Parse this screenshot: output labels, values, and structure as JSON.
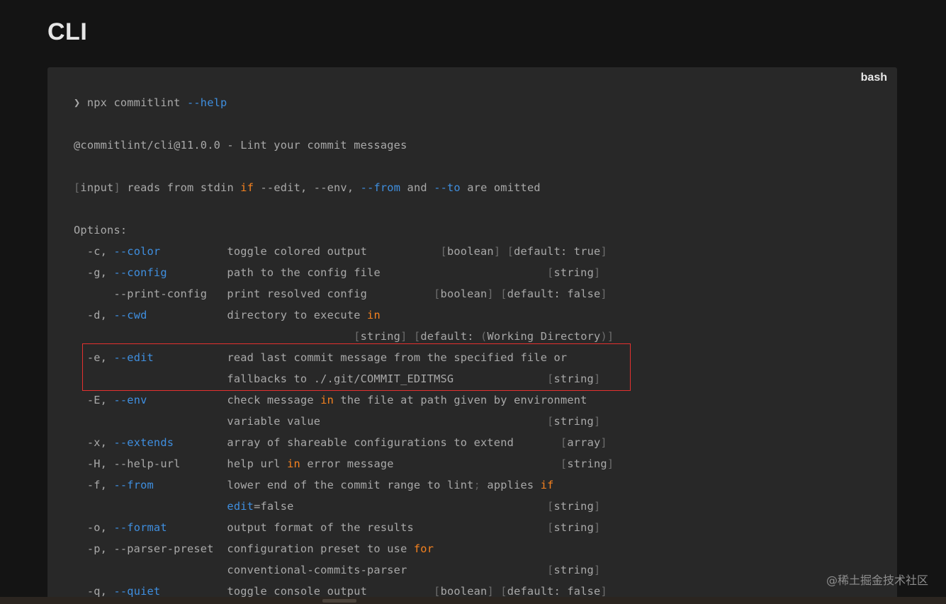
{
  "page": {
    "title": "CLI"
  },
  "code_block": {
    "language": "bash",
    "lines": [
      [
        {
          "t": "plain",
          "v": "❯ npx commitlint "
        },
        {
          "t": "flag",
          "v": "--help"
        }
      ],
      [],
      [
        {
          "t": "plain",
          "v": "@commitlint/cli@11.0.0 - Lint your commit messages"
        }
      ],
      [],
      [
        {
          "t": "br",
          "v": "["
        },
        {
          "t": "plain",
          "v": "input"
        },
        {
          "t": "br",
          "v": "]"
        },
        {
          "t": "plain",
          "v": " reads from stdin "
        },
        {
          "t": "kw",
          "v": "if"
        },
        {
          "t": "plain",
          "v": " --edit, --env, "
        },
        {
          "t": "flag",
          "v": "--from"
        },
        {
          "t": "plain",
          "v": " and "
        },
        {
          "t": "flag",
          "v": "--to"
        },
        {
          "t": "plain",
          "v": " are omitted"
        }
      ],
      [],
      [
        {
          "t": "plain",
          "v": "Options:"
        }
      ],
      [
        {
          "t": "plain",
          "v": "  -c, "
        },
        {
          "t": "flag",
          "v": "--color"
        },
        {
          "t": "plain",
          "v": "          toggle colored output           "
        },
        {
          "t": "br",
          "v": "["
        },
        {
          "t": "plain",
          "v": "boolean"
        },
        {
          "t": "br",
          "v": "]"
        },
        {
          "t": "plain",
          "v": " "
        },
        {
          "t": "br",
          "v": "["
        },
        {
          "t": "plain",
          "v": "default: true"
        },
        {
          "t": "br",
          "v": "]"
        }
      ],
      [
        {
          "t": "plain",
          "v": "  -g, "
        },
        {
          "t": "flag",
          "v": "--config"
        },
        {
          "t": "plain",
          "v": "         path to the config file                         "
        },
        {
          "t": "br",
          "v": "["
        },
        {
          "t": "plain",
          "v": "string"
        },
        {
          "t": "br",
          "v": "]"
        }
      ],
      [
        {
          "t": "plain",
          "v": "      --print-config   print resolved config          "
        },
        {
          "t": "br",
          "v": "["
        },
        {
          "t": "plain",
          "v": "boolean"
        },
        {
          "t": "br",
          "v": "]"
        },
        {
          "t": "plain",
          "v": " "
        },
        {
          "t": "br",
          "v": "["
        },
        {
          "t": "plain",
          "v": "default: false"
        },
        {
          "t": "br",
          "v": "]"
        }
      ],
      [
        {
          "t": "plain",
          "v": "  -d, "
        },
        {
          "t": "flag",
          "v": "--cwd"
        },
        {
          "t": "plain",
          "v": "            directory to execute "
        },
        {
          "t": "kw",
          "v": "in"
        }
      ],
      [
        {
          "t": "plain",
          "v": "                                          "
        },
        {
          "t": "br",
          "v": "["
        },
        {
          "t": "plain",
          "v": "string"
        },
        {
          "t": "br",
          "v": "]"
        },
        {
          "t": "plain",
          "v": " "
        },
        {
          "t": "br",
          "v": "["
        },
        {
          "t": "plain",
          "v": "default: "
        },
        {
          "t": "br",
          "v": "("
        },
        {
          "t": "plain",
          "v": "Working Directory"
        },
        {
          "t": "br",
          "v": ")"
        },
        {
          "t": "br",
          "v": "]"
        }
      ],
      [
        {
          "t": "plain",
          "v": "  -e, "
        },
        {
          "t": "flag",
          "v": "--edit"
        },
        {
          "t": "plain",
          "v": "           read last commit message from the specified file or"
        }
      ],
      [
        {
          "t": "plain",
          "v": "                       fallbacks to ./.git/COMMIT_EDITMSG              "
        },
        {
          "t": "br",
          "v": "["
        },
        {
          "t": "plain",
          "v": "string"
        },
        {
          "t": "br",
          "v": "]"
        }
      ],
      [
        {
          "t": "plain",
          "v": "  -E, "
        },
        {
          "t": "flag",
          "v": "--env"
        },
        {
          "t": "plain",
          "v": "            check message "
        },
        {
          "t": "kw",
          "v": "in"
        },
        {
          "t": "plain",
          "v": " the file at path given by environment"
        }
      ],
      [
        {
          "t": "plain",
          "v": "                       variable value                                  "
        },
        {
          "t": "br",
          "v": "["
        },
        {
          "t": "plain",
          "v": "string"
        },
        {
          "t": "br",
          "v": "]"
        }
      ],
      [
        {
          "t": "plain",
          "v": "  -x, "
        },
        {
          "t": "flag",
          "v": "--extends"
        },
        {
          "t": "plain",
          "v": "        array of shareable configurations to extend       "
        },
        {
          "t": "br",
          "v": "["
        },
        {
          "t": "plain",
          "v": "array"
        },
        {
          "t": "br",
          "v": "]"
        }
      ],
      [
        {
          "t": "plain",
          "v": "  -H, --help-url       help url "
        },
        {
          "t": "kw",
          "v": "in"
        },
        {
          "t": "plain",
          "v": " error message                         "
        },
        {
          "t": "br",
          "v": "["
        },
        {
          "t": "plain",
          "v": "string"
        },
        {
          "t": "br",
          "v": "]"
        }
      ],
      [
        {
          "t": "plain",
          "v": "  -f, "
        },
        {
          "t": "flag",
          "v": "--from"
        },
        {
          "t": "plain",
          "v": "           lower end of the commit range to lint"
        },
        {
          "t": "punc",
          "v": ";"
        },
        {
          "t": "plain",
          "v": " applies "
        },
        {
          "t": "kw",
          "v": "if"
        }
      ],
      [
        {
          "t": "plain",
          "v": "                       "
        },
        {
          "t": "flag",
          "v": "edit"
        },
        {
          "t": "plain",
          "v": "=false                                      "
        },
        {
          "t": "br",
          "v": "["
        },
        {
          "t": "plain",
          "v": "string"
        },
        {
          "t": "br",
          "v": "]"
        }
      ],
      [
        {
          "t": "plain",
          "v": "  -o, "
        },
        {
          "t": "flag",
          "v": "--format"
        },
        {
          "t": "plain",
          "v": "         output format of the results                    "
        },
        {
          "t": "br",
          "v": "["
        },
        {
          "t": "plain",
          "v": "string"
        },
        {
          "t": "br",
          "v": "]"
        }
      ],
      [
        {
          "t": "plain",
          "v": "  -p, --parser-preset  configuration preset to use "
        },
        {
          "t": "kw",
          "v": "for"
        }
      ],
      [
        {
          "t": "plain",
          "v": "                       conventional-commits-parser                     "
        },
        {
          "t": "br",
          "v": "["
        },
        {
          "t": "plain",
          "v": "string"
        },
        {
          "t": "br",
          "v": "]"
        }
      ],
      [
        {
          "t": "plain",
          "v": "  -q, "
        },
        {
          "t": "flag",
          "v": "--quiet"
        },
        {
          "t": "plain",
          "v": "          toggle console output          "
        },
        {
          "t": "br",
          "v": "["
        },
        {
          "t": "plain",
          "v": "boolean"
        },
        {
          "t": "br",
          "v": "]"
        },
        {
          "t": "plain",
          "v": " "
        },
        {
          "t": "br",
          "v": "["
        },
        {
          "t": "plain",
          "v": "default: false"
        },
        {
          "t": "br",
          "v": "]"
        }
      ]
    ]
  },
  "watermark": "@稀土掘金技术社区",
  "colors": {
    "page_bg": "#141414",
    "code_bg": "#282828",
    "keyword": "#f6821f",
    "flag": "#3f8fe0",
    "highlight_border": "#e5312f"
  }
}
